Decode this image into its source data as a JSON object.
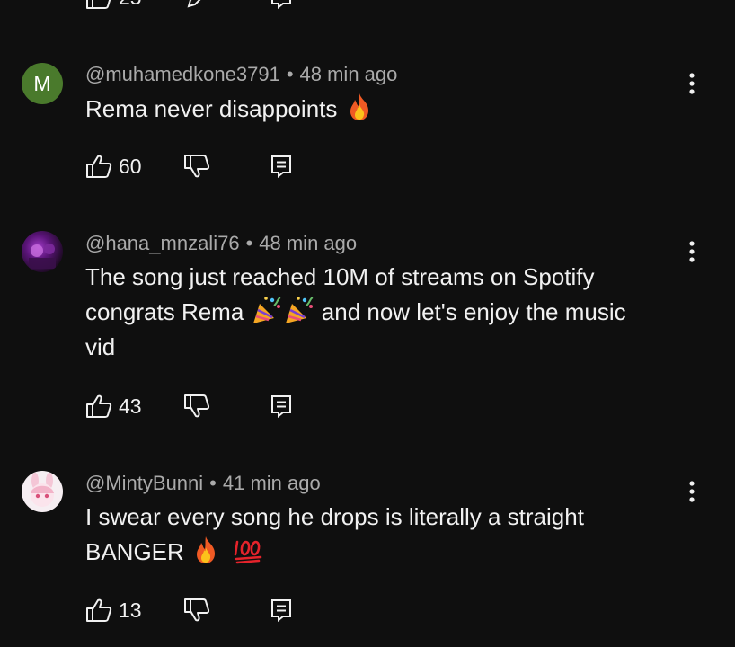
{
  "top_partial": {
    "like_count": "25"
  },
  "comments": [
    {
      "avatar_letter": "M",
      "author": "@muhamedkone3791",
      "separator": "•",
      "time": "48 min ago",
      "text": "Rema never disappoints",
      "emoji": [
        "fire"
      ],
      "like_count": "60"
    },
    {
      "author": "@hana_mnzali76",
      "separator": "•",
      "time": "48 min ago",
      "text_line1": "The song just reached 10M of streams on Spotify",
      "text_line2_start": "congrats Rema",
      "text_line2_end": "and now let's enjoy the music",
      "text_line3": "vid",
      "emoji": [
        "party-popper",
        "party-popper"
      ],
      "like_count": "43"
    },
    {
      "author": "@MintyBunni",
      "separator": "•",
      "time": "41 min ago",
      "text_line1": "I swear every song he drops is literally a straight",
      "text_line2": "BANGER",
      "emoji": [
        "fire",
        "hundred-points"
      ],
      "like_count": "13"
    }
  ],
  "icons": {
    "like": "thumbs-up-icon",
    "dislike": "thumbs-down-icon",
    "reply": "reply-icon",
    "more": "more-vertical-icon"
  },
  "colors": {
    "background": "#0f0f0f",
    "text": "#f1f1f1",
    "meta_text": "#aaaaaa",
    "avatar_m": "#4a7a2c"
  }
}
